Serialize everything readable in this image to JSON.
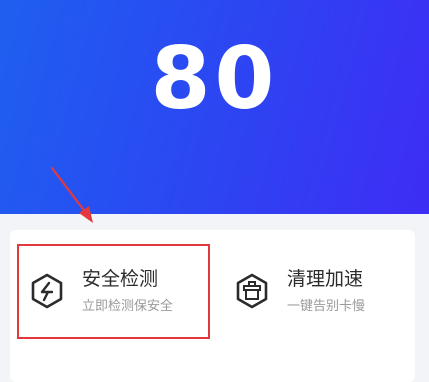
{
  "score": {
    "value": "80"
  },
  "features": [
    {
      "title": "安全检测",
      "subtitle": "立即检测保安全",
      "icon": "lightning-shield-icon"
    },
    {
      "title": "清理加速",
      "subtitle": "一键告别卡慢",
      "icon": "trash-cleanup-icon"
    }
  ],
  "colors": {
    "hero_start": "#1f5ff0",
    "hero_end": "#3e2df4",
    "annotation_red": "#e4393c",
    "title_text": "#2b2b2b",
    "subtitle_text": "#9a9a9a"
  }
}
